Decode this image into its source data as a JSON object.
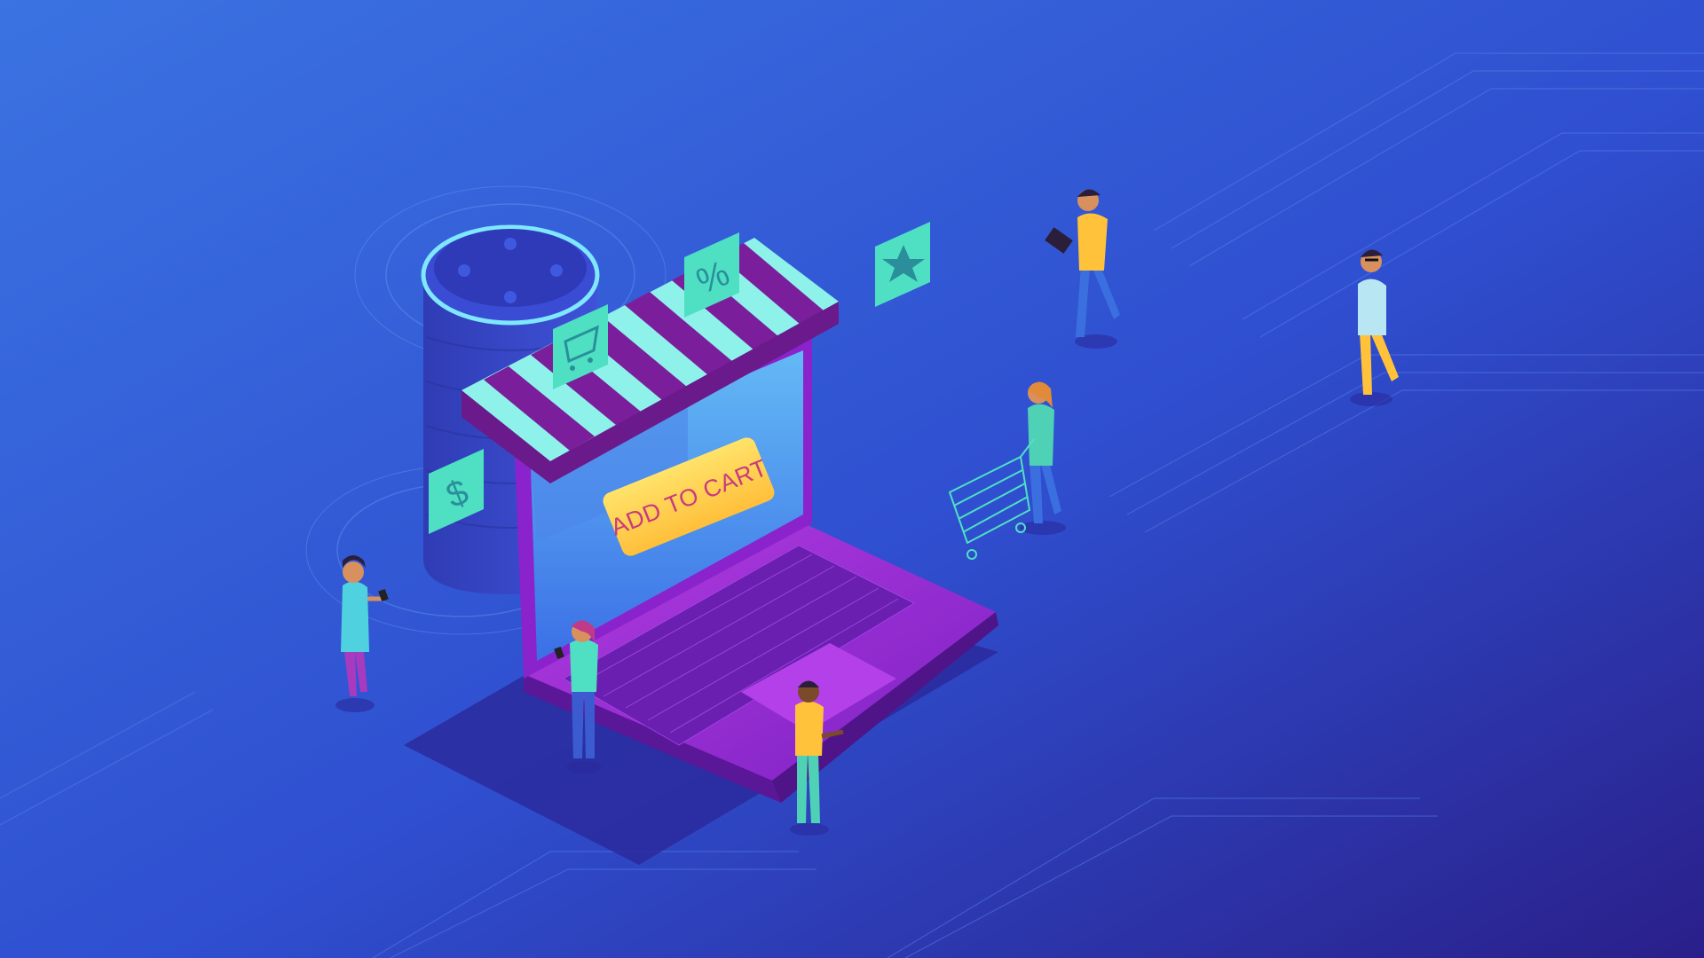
{
  "scene": {
    "add_to_cart_label": "ADD TO CART",
    "float_icons": [
      "shopping-cart-icon",
      "percent-icon",
      "dollar-icon",
      "star-icon"
    ],
    "icon_glyphs": {
      "percent": "%",
      "dollar": "$"
    },
    "people": [
      "woman-with-phone-left",
      "woman-on-laptop",
      "man-on-laptop",
      "man-with-tablet",
      "woman-with-cart",
      "man-walking-right"
    ]
  },
  "colors": {
    "background_top": "#3a6fe0",
    "background_bottom": "#2a1f8f",
    "laptop_body": "#9b2fd8",
    "laptop_screen": "#5aa0f0",
    "awning_stripe_light": "#8ff2ea",
    "awning_stripe_dark": "#7a1e9c",
    "button_fill": "#ffd24a",
    "button_text": "#c93a7e",
    "icon_tile": "#4fe0c4",
    "speaker": "#3a48c8"
  }
}
